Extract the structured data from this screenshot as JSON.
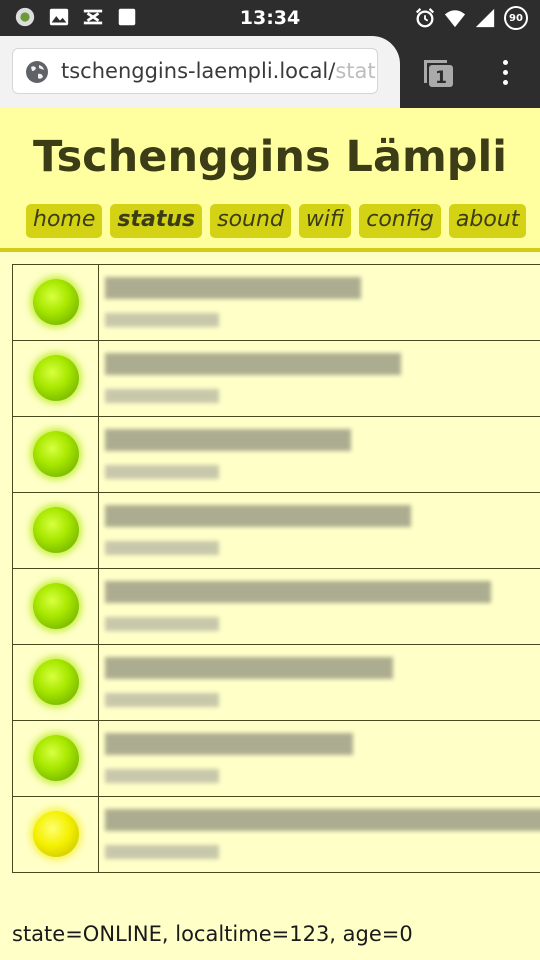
{
  "status_bar": {
    "time": "13:34",
    "battery": "90",
    "left_icons": [
      "sync-icon",
      "image-icon",
      "usb-icon",
      "square-icon"
    ],
    "right_icons": [
      "alarm-icon",
      "wifi-icon",
      "signal-icon"
    ]
  },
  "browser": {
    "url_main": "tschenggins-laempli.local/",
    "url_faded": "statu",
    "tab_count": "1"
  },
  "page": {
    "title": "Tschenggins Lämpli",
    "nav": [
      {
        "label": "home",
        "active": false
      },
      {
        "label": "status",
        "active": true
      },
      {
        "label": "sound",
        "active": false
      },
      {
        "label": "wifi",
        "active": false
      },
      {
        "label": "config",
        "active": false
      },
      {
        "label": "about",
        "active": false
      }
    ]
  },
  "status_rows": [
    {
      "led": "green"
    },
    {
      "led": "green"
    },
    {
      "led": "green"
    },
    {
      "led": "green"
    },
    {
      "led": "green"
    },
    {
      "led": "green"
    },
    {
      "led": "green"
    },
    {
      "led": "yellow"
    }
  ],
  "colors": {
    "led_green": "#a8e800",
    "led_yellow": "#f4f000",
    "header_bg": "#ffffa0",
    "page_bg": "#ffffc8",
    "nav_bg": "#d4d214"
  },
  "footer": {
    "status_line": "state=ONLINE, localtime=123, age=0"
  }
}
